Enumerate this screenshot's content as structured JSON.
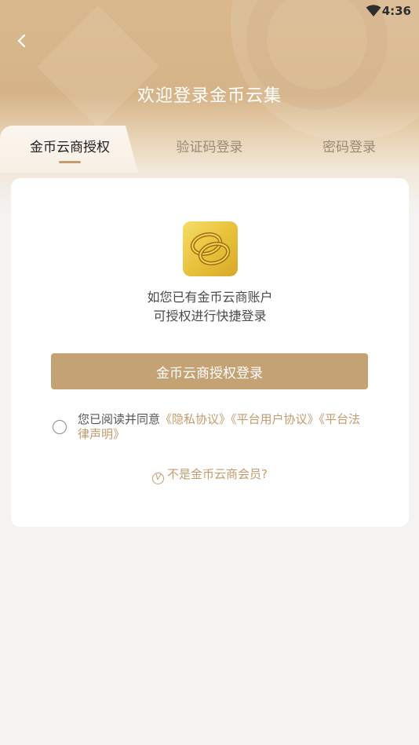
{
  "status_bar": {
    "time": "4:36",
    "wifi_icon": "wifi-icon"
  },
  "header": {
    "title": "欢迎登录金币云集",
    "back_icon": "chevron-left-icon"
  },
  "tabs": [
    {
      "label": "金币云商授权",
      "active": true
    },
    {
      "label": "验证码登录",
      "active": false
    },
    {
      "label": "密码登录",
      "active": false
    }
  ],
  "card": {
    "logo_icon": "gold-rings-logo",
    "description_line1": "如您已有金币云商账户",
    "description_line2": "可授权进行快捷登录",
    "auth_button_label": "金币云商授权登录",
    "agreement_prefix": "您已阅读并同意",
    "agreement_link_privacy": "《隐私协议》",
    "agreement_link_user": "《平台用户协议》",
    "agreement_link_legal": "《平台法律声明》",
    "agreement_checked": false,
    "not_member_icon": "vip-icon",
    "not_member_label": "不是金币云商会员?"
  },
  "colors": {
    "accent": "#c5a274",
    "link": "#c39c6e",
    "header_gold": "#d6b488",
    "background": "#f4f3f2"
  }
}
